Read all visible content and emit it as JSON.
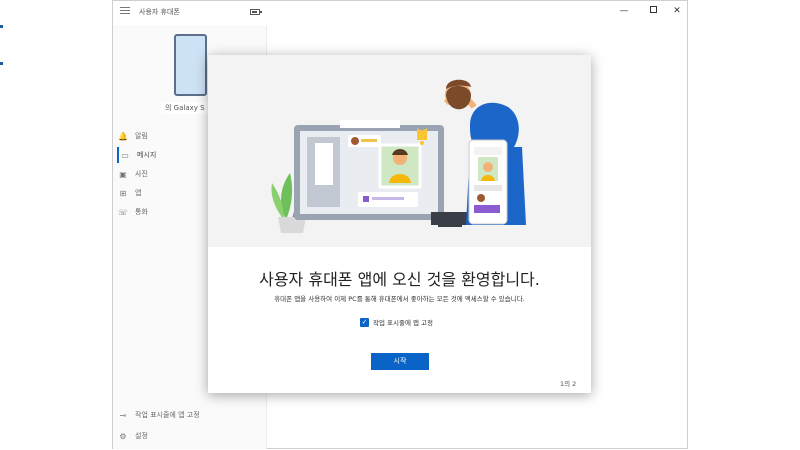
{
  "app": {
    "title": "사용자 휴대폰",
    "device_name": "의 Galaxy S"
  },
  "sidebar": {
    "items": [
      {
        "icon": "bell-icon",
        "glyph": "🔔",
        "label": "알림"
      },
      {
        "icon": "message-icon",
        "glyph": "▭",
        "label": "메시지"
      },
      {
        "icon": "photo-icon",
        "glyph": "▣",
        "label": "사진"
      },
      {
        "icon": "apps-icon",
        "glyph": "⊞",
        "label": "앱"
      },
      {
        "icon": "phone-icon",
        "glyph": "☏",
        "label": "통화"
      }
    ],
    "bottom_items": [
      {
        "icon": "pin-icon",
        "glyph": "⊸",
        "label": "작업 표시줄에 앱 고정"
      },
      {
        "icon": "gear-icon",
        "glyph": "⚙",
        "label": "설정"
      }
    ]
  },
  "window_controls": {
    "minimize": "—",
    "close": "✕"
  },
  "dialog": {
    "title": "사용자 휴대폰 앱에 오신 것을 환영합니다.",
    "subtitle": "휴대폰 앱을 사용하여 이제 PC를 통해 휴대폰에서 좋아하는 모든 것에 액세스할 수 있습니다.",
    "pin_checkbox_label": "작업 표시줄에 앱 고정",
    "pin_checked": true,
    "start_button": "시작",
    "page_indicator": "1의 2"
  },
  "colors": {
    "accent": "#0a64c8",
    "illustration_bg": "#f3f3f3",
    "character_shirt": "#1d66c9",
    "character_beard": "#7a4a2a"
  }
}
